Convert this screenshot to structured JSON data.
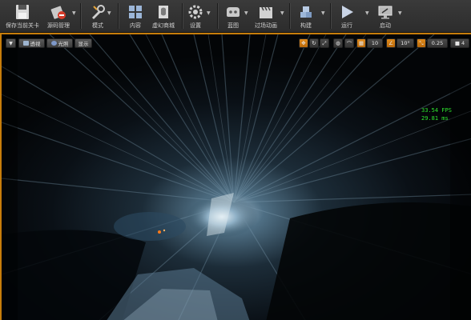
{
  "toolbar": {
    "save": {
      "label": "保存当前关卡",
      "icon": "floppy-disk-icon"
    },
    "source_control": {
      "label": "源码管理",
      "icon": "source-control-icon"
    },
    "modes": {
      "label": "模式",
      "icon": "modes-wrench-icon"
    },
    "content": {
      "label": "内容",
      "icon": "content-browser-icon"
    },
    "marketplace": {
      "label": "虚幻商城",
      "icon": "marketplace-icon"
    },
    "settings": {
      "label": "设置",
      "icon": "settings-gear-icon"
    },
    "blueprints": {
      "label": "蓝图",
      "icon": "blueprint-controller-icon"
    },
    "cinematics": {
      "label": "过场动画",
      "icon": "clapperboard-icon"
    },
    "build": {
      "label": "构建",
      "icon": "build-cubes-icon"
    },
    "play": {
      "label": "运行",
      "icon": "play-triangle-icon"
    },
    "launch": {
      "label": "启动",
      "icon": "launch-monitor-icon"
    }
  },
  "viewport": {
    "menu_icon": "chevron-down-icon",
    "perspective_label": "透视",
    "lit_label": "光照",
    "show_label": "显示",
    "grid_snap_value": "10",
    "rotation_snap_value": "10°",
    "scale_snap_value": "0.25",
    "camera_speed_value": "4",
    "stats": {
      "fps": "33.54 FPS",
      "ms": "29.81 ms"
    }
  },
  "colors": {
    "accent": "#c77d0b",
    "stats_text": "#2ee62e",
    "toolbar_bg": "#2c2c2c"
  }
}
